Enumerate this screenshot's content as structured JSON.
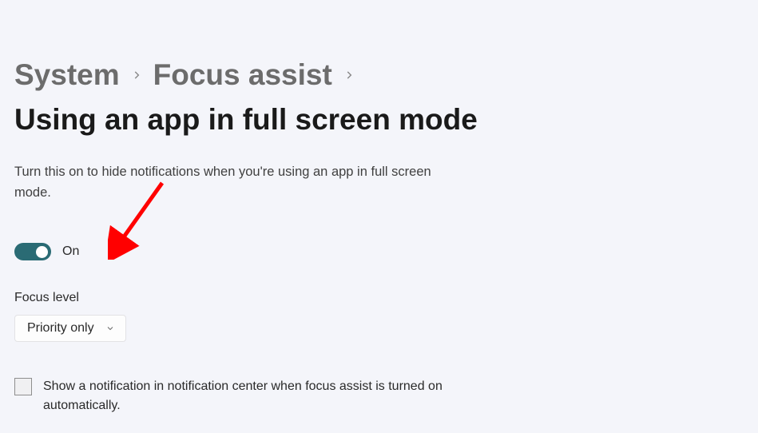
{
  "breadcrumb": {
    "items": [
      {
        "label": "System"
      },
      {
        "label": "Focus assist"
      }
    ],
    "current": "Using an app in full screen mode"
  },
  "description": "Turn this on to hide notifications when you're using an app in full screen mode.",
  "toggle": {
    "state_label": "On"
  },
  "focus_level": {
    "label": "Focus level",
    "value": "Priority only"
  },
  "checkbox": {
    "label": "Show a notification in notification center when focus assist is turned on automatically."
  },
  "annotation": {
    "arrow_color": "#ff0000"
  }
}
